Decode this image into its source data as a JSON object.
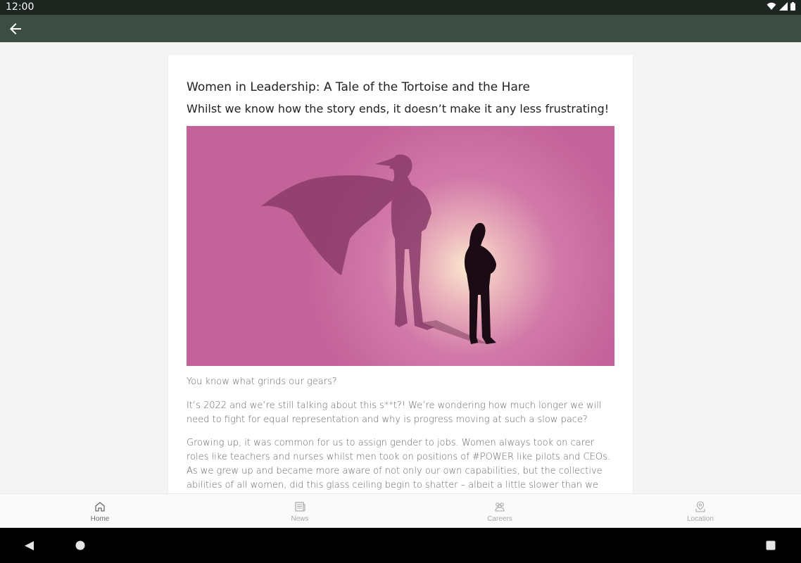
{
  "status_bar": {
    "time": "12:00"
  },
  "article": {
    "title": "Women in Leadership: A Tale of the Tortoise and the Hare",
    "subtitle": "Whilst we know how the story ends, it doesn’t make it any less frustrating!",
    "paragraphs": [
      "You know what grinds our gears?",
      "It’s 2022 and we’re still talking about this s**t?! We’re wondering how much longer we will need to fight for equal representation and why is progress moving at such a slow pace?",
      "Growing up, it was common for us to assign gender to jobs. Women always took on carer roles like teachers and nurses whilst men took on positions of #POWER like pilots and CEOs. As we grew up and became more aware of not only our own capabilities, but the collective abilities of all women, did this glass ceiling begin to shatter – albeit a little slower than we would like, but hey, we’ve all read the"
    ]
  },
  "bottom_nav": [
    {
      "label": "Home",
      "icon": "home-icon",
      "active": true
    },
    {
      "label": "News",
      "icon": "news-icon",
      "active": false
    },
    {
      "label": "Careers",
      "icon": "careers-icon",
      "active": false
    },
    {
      "label": "Location",
      "icon": "location-icon",
      "active": false
    }
  ],
  "colors": {
    "app_bar": "#3c4d43",
    "status_bar": "#1c2520",
    "hero_background": "#c3639a"
  }
}
